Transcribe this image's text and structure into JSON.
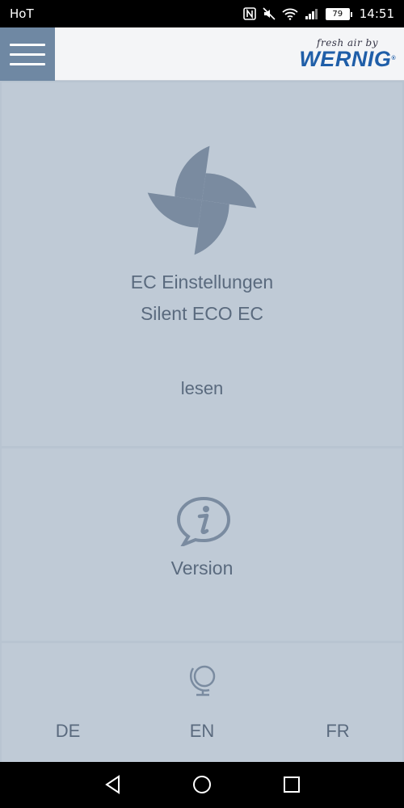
{
  "statusbar": {
    "carrier": "HoT",
    "battery": "79",
    "time": "14:51"
  },
  "header": {
    "brand_tagline": "fresh air by",
    "brand_name": "WERNIG",
    "brand_mark": "®"
  },
  "ec_panel": {
    "title": "EC Einstellungen",
    "subtitle": "Silent ECO EC",
    "action": "lesen"
  },
  "version_panel": {
    "label": "Version"
  },
  "language_panel": {
    "languages": [
      "DE",
      "EN",
      "FR"
    ]
  },
  "colors": {
    "menu_bg": "#6f88a3",
    "panel_bg": "#bfcad6",
    "text": "#5a6a7e",
    "icon": "#7a8ba0",
    "brand": "#1f5ea8"
  }
}
